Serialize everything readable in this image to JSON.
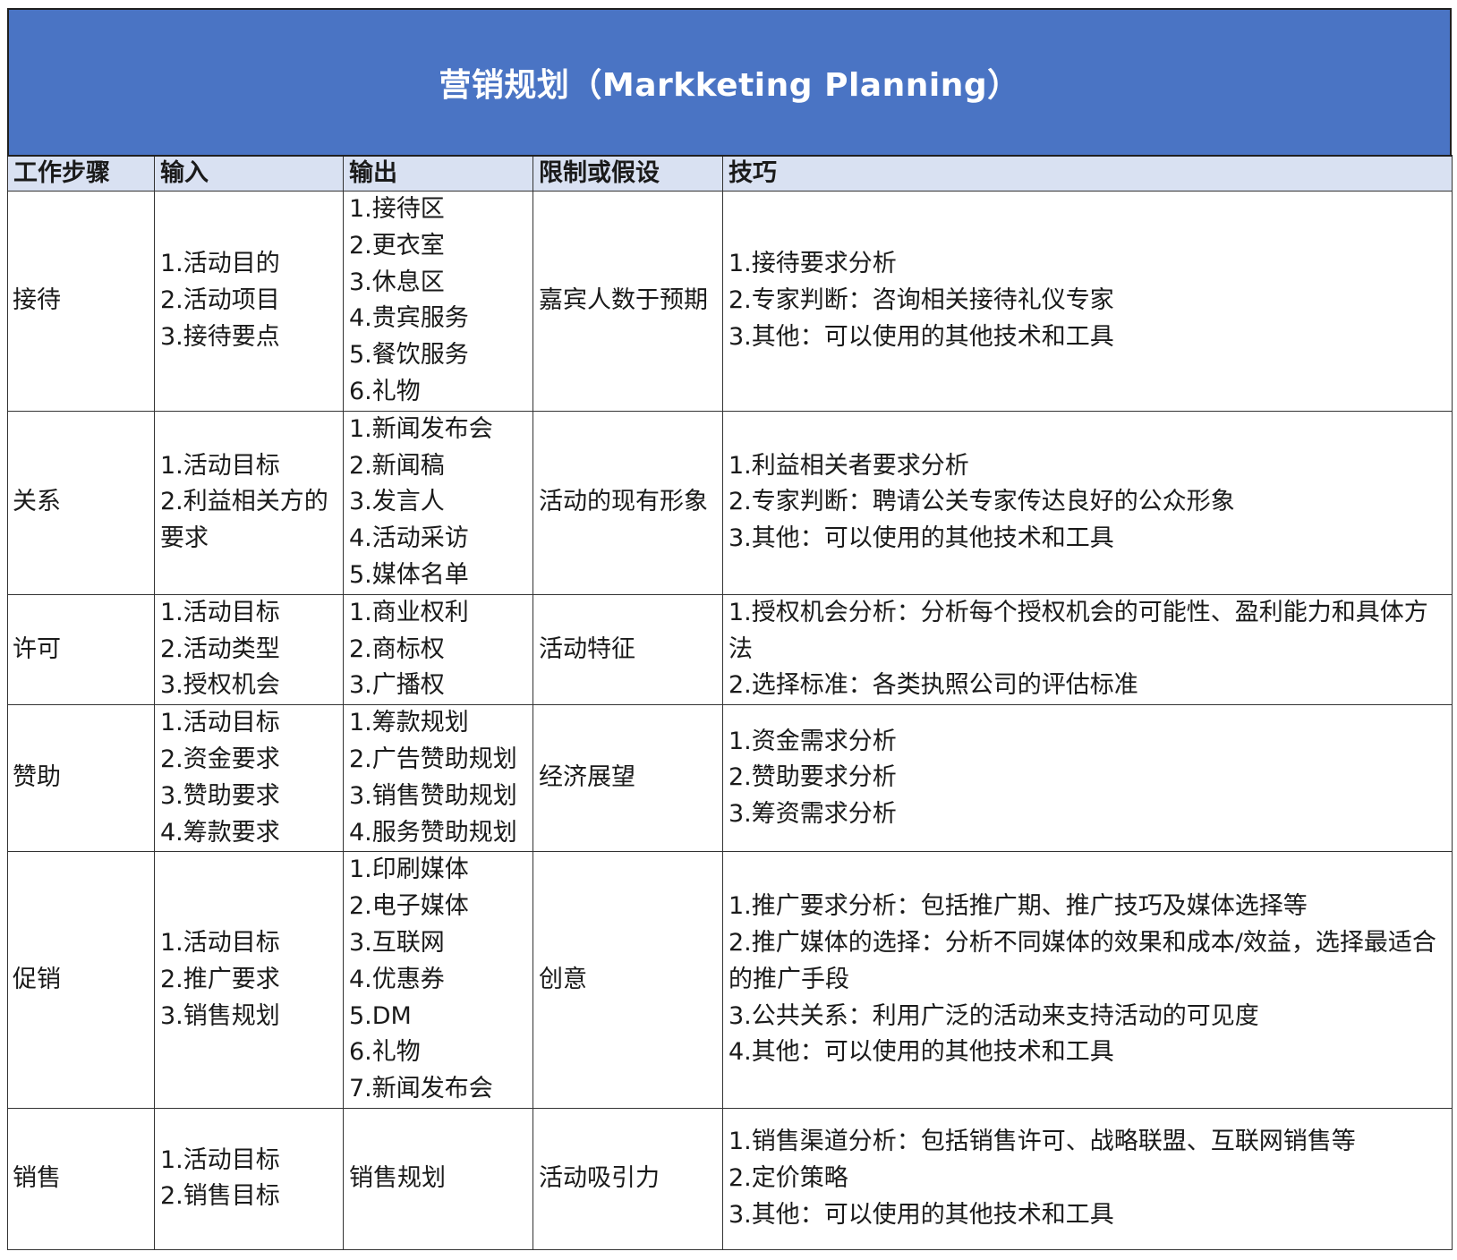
{
  "title": "营销规划（Markketing Planning）",
  "headers": [
    "工作步骤",
    "输入",
    "输出",
    "限制或假设",
    "技巧"
  ],
  "rows": [
    {
      "step": "接待",
      "inputs": [
        "1.活动目的",
        "2.活动项目",
        "3.接待要点"
      ],
      "outputs": [
        "1.接待区",
        "2.更衣室",
        "3.休息区",
        "4.贵宾服务",
        "5.餐饮服务",
        "6.礼物"
      ],
      "constraint": "嘉宾人数于预期",
      "techniques": [
        "1.接待要求分析",
        "2.专家判断：咨询相关接待礼仪专家",
        "3.其他：可以使用的其他技术和工具"
      ]
    },
    {
      "step": "关系",
      "inputs": [
        "1.活动目标",
        "2.利益相关方的要求"
      ],
      "outputs": [
        "1.新闻发布会",
        "2.新闻稿",
        "3.发言人",
        "4.活动采访",
        "5.媒体名单"
      ],
      "constraint": "活动的现有形象",
      "techniques": [
        "1.利益相关者要求分析",
        "2.专家判断：聘请公关专家传达良好的公众形象",
        "3.其他：可以使用的其他技术和工具"
      ]
    },
    {
      "step": "许可",
      "inputs": [
        "1.活动目标",
        "2.活动类型",
        "3.授权机会"
      ],
      "outputs": [
        "1.商业权利",
        "2.商标权",
        "3.广播权"
      ],
      "constraint": "活动特征",
      "techniques": [
        "1.授权机会分析：分析每个授权机会的可能性、盈利能力和具体方法",
        "2.选择标准：各类执照公司的评估标准"
      ]
    },
    {
      "step": "赞助",
      "inputs": [
        "1.活动目标",
        "2.资金要求",
        "3.赞助要求",
        "4.筹款要求"
      ],
      "outputs": [
        "1.筹款规划",
        "2.广告赞助规划",
        "3.销售赞助规划",
        "4.服务赞助规划"
      ],
      "constraint": "经济展望",
      "techniques": [
        "1.资金需求分析",
        "2.赞助要求分析",
        "3.筹资需求分析"
      ]
    },
    {
      "step": "促销",
      "inputs": [
        "1.活动目标",
        "2.推广要求",
        "3.销售规划"
      ],
      "outputs": [
        "1.印刷媒体",
        "2.电子媒体",
        "3.互联网",
        "4.优惠券",
        "5.DM",
        "6.礼物",
        "7.新闻发布会"
      ],
      "constraint": "创意",
      "techniques": [
        "1.推广要求分析：包括推广期、推广技巧及媒体选择等",
        "2.推广媒体的选择：分析不同媒体的效果和成本/效益，选择最适合的推广手段",
        "3.公共关系：利用广泛的活动来支持活动的可见度",
        "4.其他：可以使用的其他技术和工具"
      ]
    },
    {
      "step": "销售",
      "inputs": [
        "1.活动目标",
        "2.销售目标"
      ],
      "outputs": [
        "销售规划"
      ],
      "constraint": "活动吸引力",
      "techniques": [
        "1.销售渠道分析：包括销售许可、战略联盟、互联网销售等",
        "2.定价策略",
        "3.其他：可以使用的其他技术和工具"
      ]
    }
  ]
}
